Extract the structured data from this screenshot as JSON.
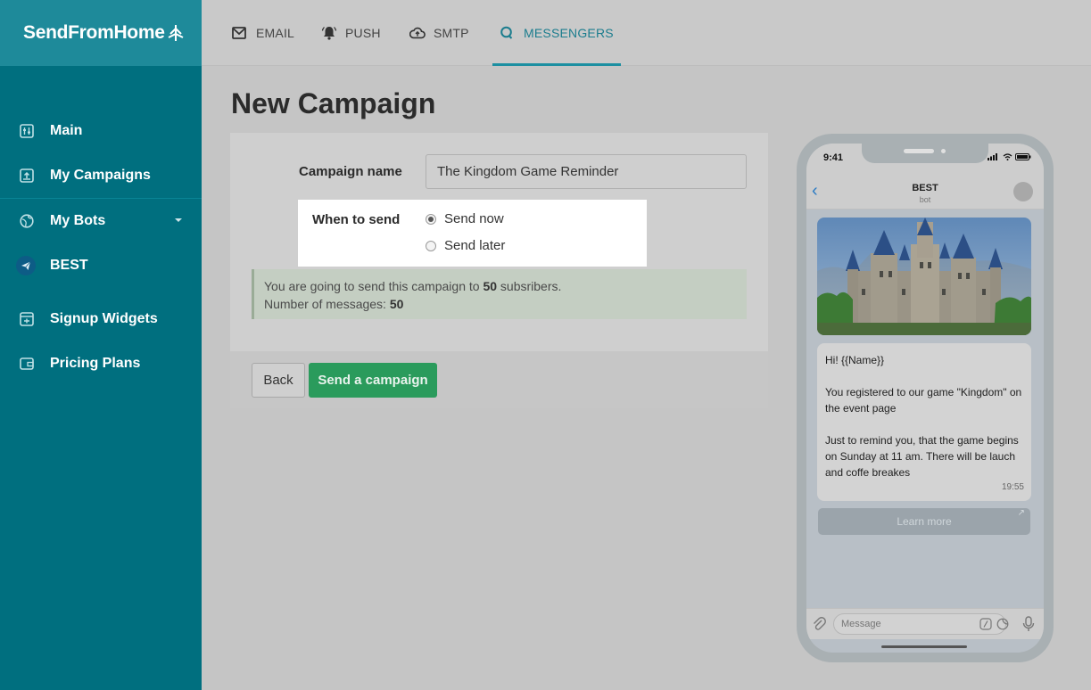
{
  "brand": {
    "name": "SendFromHome"
  },
  "sidebar": {
    "items": [
      {
        "label": "Main",
        "icon": "sliders-icon"
      },
      {
        "label": "My Campaigns",
        "icon": "campaign-upload-icon"
      },
      {
        "label": "My Bots",
        "icon": "globe-icon",
        "has_dropdown": true
      },
      {
        "label": "BEST",
        "icon": "telegram-icon"
      },
      {
        "label": "Signup Widgets",
        "icon": "widget-icon"
      },
      {
        "label": "Pricing Plans",
        "icon": "wallet-icon"
      }
    ]
  },
  "tabs": [
    {
      "label": "EMAIL",
      "icon": "envelope-icon"
    },
    {
      "label": "PUSH",
      "icon": "bell-icon"
    },
    {
      "label": "SMTP",
      "icon": "cloud-upload-icon"
    },
    {
      "label": "MESSENGERS",
      "icon": "chat-bubble-icon",
      "active": true
    }
  ],
  "page": {
    "title": "New Campaign"
  },
  "form": {
    "campaign_name_label": "Campaign name",
    "campaign_name_value": "The Kingdom Game Reminder",
    "when_label": "When to send",
    "options": [
      "Send now",
      "Send later"
    ],
    "selected_option": "Send now",
    "info_line1_prefix": "You are going to send this campaign to",
    "subscribers": "50",
    "info_line1_suffix": "subsribers.",
    "info_line2_prefix": "Number of messages:",
    "messages": "50",
    "back_label": "Back",
    "send_label": "Send a campaign"
  },
  "preview": {
    "status_time": "9:41",
    "chat_title": "BEST",
    "chat_subtitle": "bot",
    "message_lines": [
      "Hi! {{Name}}",
      "You registered to our game \"Kingdom\" on the event page",
      "Just to remind you, that the game begins on Sunday at 11 am. There will be lauch and coffe breakes"
    ],
    "message_time": "19:55",
    "button_label": "Learn more",
    "composer_placeholder": "Message"
  },
  "colors": {
    "sidebar": "#006f7f",
    "accent": "#1c8fa1",
    "send_button": "#2a9b5c"
  }
}
